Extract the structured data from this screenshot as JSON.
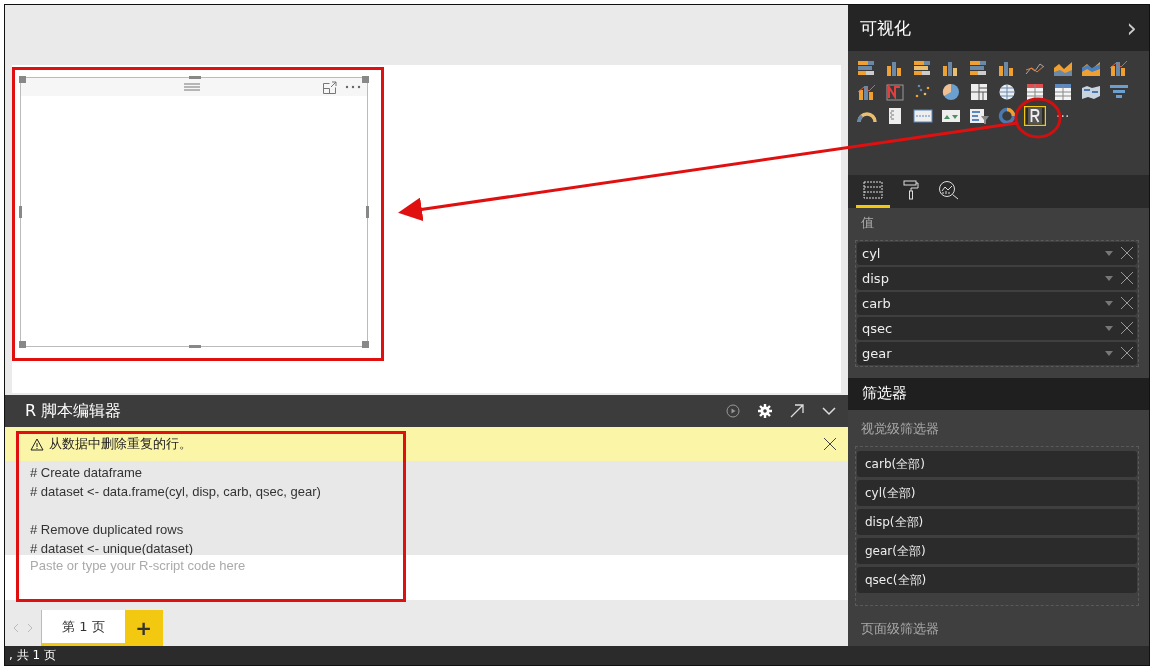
{
  "editor": {
    "title": "R 脚本编辑器",
    "warning": "从数据中删除重复的行。",
    "code_blocks": [
      [
        "# Create dataframe",
        "# dataset <- data.frame(cyl, disp, carb, qsec, gear)"
      ],
      [
        "# Remove duplicated rows",
        "# dataset <- unique(dataset)"
      ]
    ],
    "placeholder": "Paste or type your R-script code here"
  },
  "page_tabs": [
    {
      "label": "第 1 页",
      "selected": true
    }
  ],
  "add_page": "+",
  "status_bar": ", 共 1 页",
  "visualizations": {
    "title": "可视化",
    "chevron": "›",
    "gallery": [
      {
        "kind": "stacked-bar",
        "selected": false
      },
      {
        "kind": "stacked-column",
        "selected": false
      },
      {
        "kind": "clustered-bar",
        "selected": false
      },
      {
        "kind": "clustered-column",
        "selected": false
      },
      {
        "kind": "bar-100",
        "selected": false
      },
      {
        "kind": "column-100",
        "selected": false
      },
      {
        "kind": "line",
        "selected": false
      },
      {
        "kind": "area",
        "selected": false
      },
      {
        "kind": "ribbon-area",
        "selected": false
      },
      {
        "kind": "line-column",
        "selected": false
      },
      {
        "kind": "line-column",
        "selected": false
      },
      {
        "kind": "ribbon",
        "selected": false
      },
      {
        "kind": "scatter",
        "selected": false
      },
      {
        "kind": "pie",
        "selected": false
      },
      {
        "kind": "treemap",
        "selected": false
      },
      {
        "kind": "map",
        "selected": false
      },
      {
        "kind": "table",
        "selected": false
      },
      {
        "kind": "matrix",
        "selected": false
      },
      {
        "kind": "filled-map",
        "selected": false
      },
      {
        "kind": "funnel",
        "selected": false
      },
      {
        "kind": "gauge",
        "selected": false
      },
      {
        "kind": "multi-card",
        "selected": false
      },
      {
        "kind": "card",
        "selected": false
      },
      {
        "kind": "kpi",
        "selected": false
      },
      {
        "kind": "slicer",
        "selected": false
      },
      {
        "kind": "donut",
        "selected": false
      },
      {
        "kind": "r-script",
        "selected": true
      }
    ],
    "more": "···",
    "tabs": [
      {
        "kind": "fields",
        "selected": true
      },
      {
        "kind": "format",
        "selected": false
      },
      {
        "kind": "analytics",
        "selected": false
      }
    ],
    "values_label": "值",
    "values": [
      {
        "name": "cyl"
      },
      {
        "name": "disp"
      },
      {
        "name": "carb"
      },
      {
        "name": "qsec"
      },
      {
        "name": "gear"
      }
    ]
  },
  "filters": {
    "title": "筛选器",
    "visual_level_label": "视觉级筛选器",
    "visual_level": [
      "carb(全部)",
      "cyl(全部)",
      "disp(全部)",
      "gear(全部)",
      "qsec(全部)"
    ],
    "page_level_label": "页面级筛选器"
  }
}
